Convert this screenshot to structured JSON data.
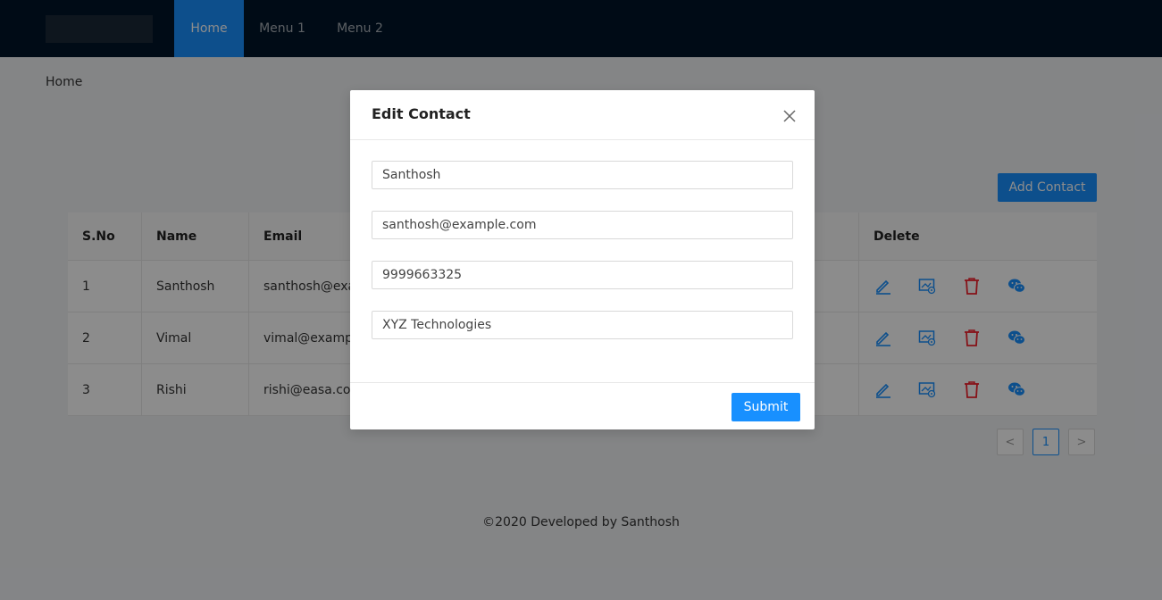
{
  "nav": {
    "items": [
      {
        "label": "Home"
      },
      {
        "label": "Menu 1"
      },
      {
        "label": "Menu 2"
      }
    ]
  },
  "breadcrumb": {
    "label": "Home"
  },
  "toolbar": {
    "add_label": "Add Contact"
  },
  "table": {
    "headers": [
      "S.No",
      "Name",
      "Email",
      "Delete"
    ],
    "rows": [
      {
        "sno": "1",
        "name": "Santhosh",
        "email": "santhosh@exan"
      },
      {
        "sno": "2",
        "name": "Vimal",
        "email": "vimal@example"
      },
      {
        "sno": "3",
        "name": "Rishi",
        "email": "rishi@easa.com"
      }
    ],
    "action_icons": [
      "edit-icon",
      "picture-icon",
      "delete-icon",
      "wechat-icon"
    ],
    "colors": {
      "edit": "#1890ff",
      "delete": "#f5222d"
    }
  },
  "pagination": {
    "prev": "<",
    "current": "1",
    "next": ">"
  },
  "footer": {
    "text": "©2020 Developed by Santhosh"
  },
  "modal": {
    "title": "Edit Contact",
    "fields": {
      "name": "Santhosh",
      "email": "santhosh@example.com",
      "phone": "9999663325",
      "company": "XYZ Technologies"
    },
    "submit_label": "Submit"
  },
  "colors": {
    "primary": "#1890ff",
    "header_bg": "#001529"
  }
}
